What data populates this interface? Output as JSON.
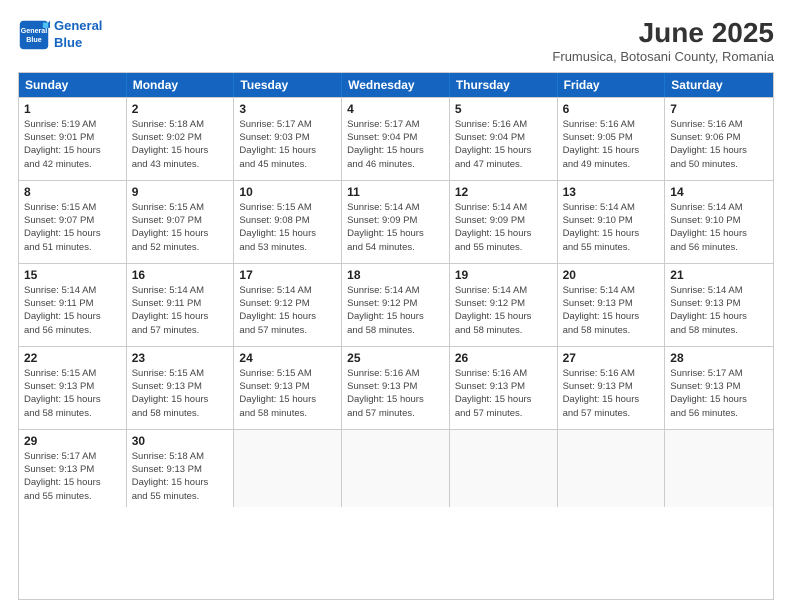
{
  "logo": {
    "line1": "General",
    "line2": "Blue"
  },
  "title": "June 2025",
  "location": "Frumusica, Botosani County, Romania",
  "header_days": [
    "Sunday",
    "Monday",
    "Tuesday",
    "Wednesday",
    "Thursday",
    "Friday",
    "Saturday"
  ],
  "rows": [
    [
      {
        "day": "",
        "info": ""
      },
      {
        "day": "2",
        "info": "Sunrise: 5:18 AM\nSunset: 9:02 PM\nDaylight: 15 hours\nand 43 minutes."
      },
      {
        "day": "3",
        "info": "Sunrise: 5:17 AM\nSunset: 9:03 PM\nDaylight: 15 hours\nand 45 minutes."
      },
      {
        "day": "4",
        "info": "Sunrise: 5:17 AM\nSunset: 9:04 PM\nDaylight: 15 hours\nand 46 minutes."
      },
      {
        "day": "5",
        "info": "Sunrise: 5:16 AM\nSunset: 9:04 PM\nDaylight: 15 hours\nand 47 minutes."
      },
      {
        "day": "6",
        "info": "Sunrise: 5:16 AM\nSunset: 9:05 PM\nDaylight: 15 hours\nand 49 minutes."
      },
      {
        "day": "7",
        "info": "Sunrise: 5:16 AM\nSunset: 9:06 PM\nDaylight: 15 hours\nand 50 minutes."
      }
    ],
    [
      {
        "day": "8",
        "info": "Sunrise: 5:15 AM\nSunset: 9:07 PM\nDaylight: 15 hours\nand 51 minutes."
      },
      {
        "day": "9",
        "info": "Sunrise: 5:15 AM\nSunset: 9:07 PM\nDaylight: 15 hours\nand 52 minutes."
      },
      {
        "day": "10",
        "info": "Sunrise: 5:15 AM\nSunset: 9:08 PM\nDaylight: 15 hours\nand 53 minutes."
      },
      {
        "day": "11",
        "info": "Sunrise: 5:14 AM\nSunset: 9:09 PM\nDaylight: 15 hours\nand 54 minutes."
      },
      {
        "day": "12",
        "info": "Sunrise: 5:14 AM\nSunset: 9:09 PM\nDaylight: 15 hours\nand 55 minutes."
      },
      {
        "day": "13",
        "info": "Sunrise: 5:14 AM\nSunset: 9:10 PM\nDaylight: 15 hours\nand 55 minutes."
      },
      {
        "day": "14",
        "info": "Sunrise: 5:14 AM\nSunset: 9:10 PM\nDaylight: 15 hours\nand 56 minutes."
      }
    ],
    [
      {
        "day": "15",
        "info": "Sunrise: 5:14 AM\nSunset: 9:11 PM\nDaylight: 15 hours\nand 56 minutes."
      },
      {
        "day": "16",
        "info": "Sunrise: 5:14 AM\nSunset: 9:11 PM\nDaylight: 15 hours\nand 57 minutes."
      },
      {
        "day": "17",
        "info": "Sunrise: 5:14 AM\nSunset: 9:12 PM\nDaylight: 15 hours\nand 57 minutes."
      },
      {
        "day": "18",
        "info": "Sunrise: 5:14 AM\nSunset: 9:12 PM\nDaylight: 15 hours\nand 58 minutes."
      },
      {
        "day": "19",
        "info": "Sunrise: 5:14 AM\nSunset: 9:12 PM\nDaylight: 15 hours\nand 58 minutes."
      },
      {
        "day": "20",
        "info": "Sunrise: 5:14 AM\nSunset: 9:13 PM\nDaylight: 15 hours\nand 58 minutes."
      },
      {
        "day": "21",
        "info": "Sunrise: 5:14 AM\nSunset: 9:13 PM\nDaylight: 15 hours\nand 58 minutes."
      }
    ],
    [
      {
        "day": "22",
        "info": "Sunrise: 5:15 AM\nSunset: 9:13 PM\nDaylight: 15 hours\nand 58 minutes."
      },
      {
        "day": "23",
        "info": "Sunrise: 5:15 AM\nSunset: 9:13 PM\nDaylight: 15 hours\nand 58 minutes."
      },
      {
        "day": "24",
        "info": "Sunrise: 5:15 AM\nSunset: 9:13 PM\nDaylight: 15 hours\nand 58 minutes."
      },
      {
        "day": "25",
        "info": "Sunrise: 5:16 AM\nSunset: 9:13 PM\nDaylight: 15 hours\nand 57 minutes."
      },
      {
        "day": "26",
        "info": "Sunrise: 5:16 AM\nSunset: 9:13 PM\nDaylight: 15 hours\nand 57 minutes."
      },
      {
        "day": "27",
        "info": "Sunrise: 5:16 AM\nSunset: 9:13 PM\nDaylight: 15 hours\nand 57 minutes."
      },
      {
        "day": "28",
        "info": "Sunrise: 5:17 AM\nSunset: 9:13 PM\nDaylight: 15 hours\nand 56 minutes."
      }
    ],
    [
      {
        "day": "29",
        "info": "Sunrise: 5:17 AM\nSunset: 9:13 PM\nDaylight: 15 hours\nand 55 minutes."
      },
      {
        "day": "30",
        "info": "Sunrise: 5:18 AM\nSunset: 9:13 PM\nDaylight: 15 hours\nand 55 minutes."
      },
      {
        "day": "",
        "info": ""
      },
      {
        "day": "",
        "info": ""
      },
      {
        "day": "",
        "info": ""
      },
      {
        "day": "",
        "info": ""
      },
      {
        "day": "",
        "info": ""
      }
    ]
  ],
  "first_row_sunday": {
    "day": "1",
    "info": "Sunrise: 5:19 AM\nSunset: 9:01 PM\nDaylight: 15 hours\nand 42 minutes."
  }
}
